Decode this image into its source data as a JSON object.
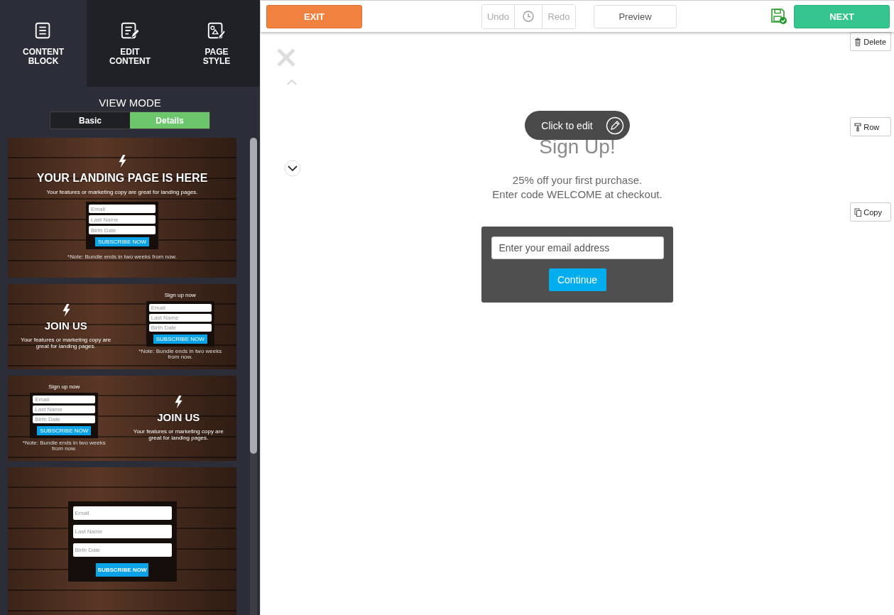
{
  "sidebar": {
    "tabs": [
      {
        "label": "CONTENT BLOCK",
        "selected": true
      },
      {
        "label": "EDIT CONTENT",
        "selected": false
      },
      {
        "label": "PAGE STYLE",
        "selected": false
      }
    ],
    "view_mode": {
      "title": "VIEW MODE",
      "options": [
        {
          "label": "Basic",
          "selected": false
        },
        {
          "label": "Details",
          "selected": true
        }
      ]
    },
    "templates": [
      {
        "kind": "centered",
        "heading": "YOUR LANDING PAGE IS HERE",
        "body": "Your features or marketing copy are great for landing pages.",
        "fields": [
          {
            "placeholder": "Email"
          },
          {
            "placeholder": "Last Name"
          },
          {
            "placeholder": "Birth Date"
          }
        ],
        "button": "SUBSCRIBE NOW",
        "note": "*Note: Bundle ends in two weeks from now."
      },
      {
        "kind": "form-right",
        "heading": "JOIN US",
        "body": "Your features or marketing copy are great for landing pages.",
        "form_title": "Sign up now",
        "fields": [
          {
            "placeholder": "Email"
          },
          {
            "placeholder": "Last Name"
          },
          {
            "placeholder": "Birth Date"
          }
        ],
        "button": "SUBSCRIBE NOW",
        "note": "*Note: Bundle ends in two weeks from now."
      },
      {
        "kind": "form-left",
        "heading": "JOIN US",
        "body": "Your features or marketing copy are great for landing pages.",
        "form_title": "Sign up now",
        "fields": [
          {
            "placeholder": "Email"
          },
          {
            "placeholder": "Last Name"
          },
          {
            "placeholder": "Birth Date"
          }
        ],
        "button": "SUBSCRIBE NOW",
        "note": "*Note: Bundle ends in two weeks from now."
      },
      {
        "kind": "form-only",
        "fields": [
          {
            "placeholder": "Email"
          },
          {
            "placeholder": "Last Name"
          },
          {
            "placeholder": "Birth Date"
          }
        ],
        "button": "SUBSCRIBE NOW"
      }
    ]
  },
  "toolbar": {
    "exit": "EXIT",
    "undo": {
      "label": "Undo",
      "disabled": true
    },
    "redo": {
      "label": "Redo",
      "disabled": true
    },
    "preview": "Preview",
    "next": "NEXT"
  },
  "canvas": {
    "edit_hint": "Click to edit",
    "title": "Sign Up!",
    "lines": [
      "25% off your first purchase.",
      "Enter code WELCOME at checkout."
    ],
    "email": {
      "placeholder": "Enter your email address"
    },
    "submit": "Continue",
    "actions": [
      {
        "kind": "delete",
        "label": "Delete"
      },
      {
        "kind": "row",
        "label": "Row"
      },
      {
        "kind": "copy",
        "label": "Copy"
      }
    ]
  }
}
